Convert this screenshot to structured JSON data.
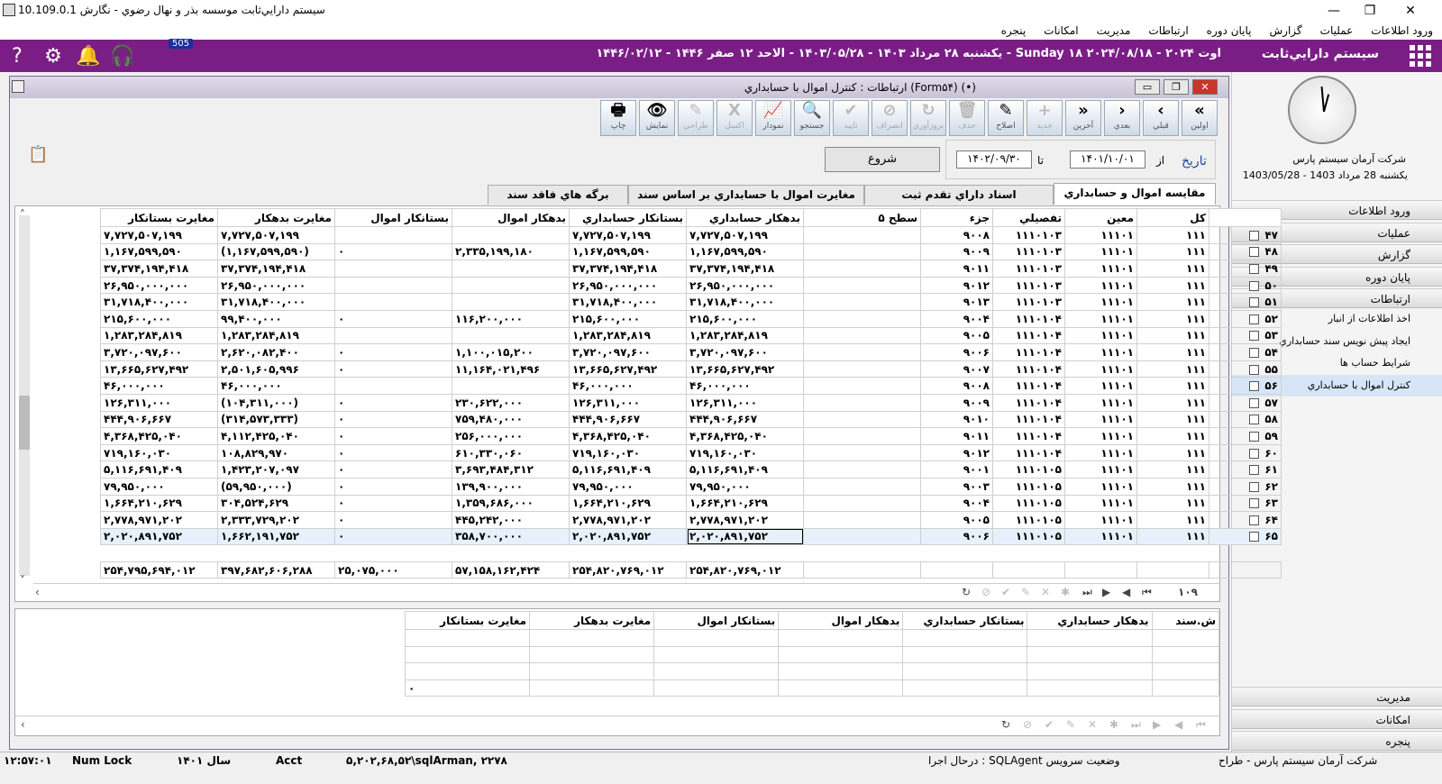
{
  "window": {
    "title": "سيستم دارايي‌ثابت موسسه بذر و نهال رضوي - نگارش 10.109.0.1"
  },
  "menubar": [
    "ورود اطلاعات",
    "عمليات",
    "گزارش",
    "پايان دوره",
    "ارتباطات",
    "مديريت",
    "امکانات",
    "پنجره"
  ],
  "topbar": {
    "brand": "سيستم دارايي‌ثابت",
    "date": "يكشنبه ۲۸ مرداد ۱۴۰۳ - ۱۴۰۳/۰۵/۲۸ - الاحد ۱۲ صفر ۱۴۴۶ - ۱۴۴۶/۰۲/۱۲ - Sunday ۱۸ اوت ۲۰۲۴ - ۲۰۲۴/۰۸/۱۸",
    "badge": "505"
  },
  "rightpanel": {
    "company": "شرکت آرمان سيستم پارس",
    "date": "يکشنبه 28 مرداد 1403 - 1403/05/28",
    "menus_top": [
      "ورود اطلاعات",
      "عمليات",
      "گزارش",
      "پايان دوره",
      "ارتباطات"
    ],
    "sub": [
      "اخذ اطلاعات از انبار",
      "ايجاد پيش نويس سند حسابداري",
      "شرايط حساب ها",
      "کنترل اموال با حسابداري"
    ],
    "menus_bottom": [
      "مديريت",
      "امکانات",
      "پنجره"
    ]
  },
  "form": {
    "title": "ارتباطات : کنترل اموال با حسابداري (Form۵۴) (•)"
  },
  "toolbar": [
    {
      "l": "اولين",
      "i": "«",
      "d": false
    },
    {
      "l": "قبلي",
      "i": "‹",
      "d": false
    },
    {
      "l": "بعدي",
      "i": "›",
      "d": false
    },
    {
      "l": "آخرين",
      "i": "»",
      "d": false
    },
    {
      "l": "جديد",
      "i": "+",
      "d": true
    },
    {
      "l": "اصلاح",
      "i": "✎",
      "d": false
    },
    {
      "l": "حذف",
      "i": "🗑",
      "d": true
    },
    {
      "l": "بروزآوري",
      "i": "↻",
      "d": true
    },
    {
      "l": "انصراف",
      "i": "⊘",
      "d": true
    },
    {
      "l": "تاييد",
      "i": "✔",
      "d": true
    },
    {
      "l": "جستجو",
      "i": "🔍",
      "d": false
    },
    {
      "l": "نمودار",
      "i": "📈",
      "d": false
    },
    {
      "l": "اکسل",
      "i": "X",
      "d": true
    },
    {
      "l": "طراحي",
      "i": "✎",
      "d": true
    },
    {
      "l": "نمايش",
      "i": "👁",
      "d": false
    },
    {
      "l": "چاپ",
      "i": "🖶",
      "d": false
    }
  ],
  "filter": {
    "date_label": "تاريخ",
    "from_label": "از",
    "from": "۱۴۰۱/۱۰/۰۱",
    "to_label": "تا",
    "to": "۱۴۰۲/۰۹/۳۰",
    "start": "شروع"
  },
  "tabs": [
    "مقايسه اموال و حسابداري",
    "اسناد داراي تقدم ثبت",
    "مغايرت اموال با حسابداري بر اساس سند",
    "برگه هاي فاقد سند"
  ],
  "columns": [
    "کل",
    "معين",
    "تفصيلي",
    "جزء",
    "سطح ۵",
    "بدهکار حسابداري",
    "بستانکار حسابداري",
    "بدهکار اموال",
    "بستانکار اموال",
    "مغايرت بدهکار",
    "مغايرت بستانکار"
  ],
  "rows": [
    [
      "۴۷",
      "۱۱۱",
      "۱۱۱۰۱",
      "۱۱۱۰۱۰۳",
      "۹۰۰۸",
      "",
      "۷,۷۲۷,۵۰۷,۱۹۹",
      "۷,۷۲۷,۵۰۷,۱۹۹",
      "",
      "",
      "۷,۷۲۷,۵۰۷,۱۹۹",
      "۷,۷۲۷,۵۰۷,۱۹۹"
    ],
    [
      "۴۸",
      "۱۱۱",
      "۱۱۱۰۱",
      "۱۱۱۰۱۰۳",
      "۹۰۰۹",
      "",
      "۱,۱۶۷,۵۹۹,۵۹۰",
      "۱,۱۶۷,۵۹۹,۵۹۰",
      "۲,۳۳۵,۱۹۹,۱۸۰",
      "۰",
      "(۱,۱۶۷,۵۹۹,۵۹۰)",
      "۱,۱۶۷,۵۹۹,۵۹۰"
    ],
    [
      "۴۹",
      "۱۱۱",
      "۱۱۱۰۱",
      "۱۱۱۰۱۰۳",
      "۹۰۱۱",
      "",
      "۳۷,۳۷۴,۱۹۴,۴۱۸",
      "۳۷,۳۷۴,۱۹۴,۴۱۸",
      "",
      "",
      "۳۷,۳۷۴,۱۹۴,۴۱۸",
      "۳۷,۳۷۴,۱۹۴,۴۱۸"
    ],
    [
      "۵۰",
      "۱۱۱",
      "۱۱۱۰۱",
      "۱۱۱۰۱۰۳",
      "۹۰۱۲",
      "",
      "۲۶,۹۵۰,۰۰۰,۰۰۰",
      "۲۶,۹۵۰,۰۰۰,۰۰۰",
      "",
      "",
      "۲۶,۹۵۰,۰۰۰,۰۰۰",
      "۲۶,۹۵۰,۰۰۰,۰۰۰"
    ],
    [
      "۵۱",
      "۱۱۱",
      "۱۱۱۰۱",
      "۱۱۱۰۱۰۳",
      "۹۰۱۳",
      "",
      "۳۱,۷۱۸,۴۰۰,۰۰۰",
      "۳۱,۷۱۸,۴۰۰,۰۰۰",
      "",
      "",
      "۳۱,۷۱۸,۴۰۰,۰۰۰",
      "۳۱,۷۱۸,۴۰۰,۰۰۰"
    ],
    [
      "۵۲",
      "۱۱۱",
      "۱۱۱۰۱",
      "۱۱۱۰۱۰۴",
      "۹۰۰۴",
      "",
      "۲۱۵,۶۰۰,۰۰۰",
      "۲۱۵,۶۰۰,۰۰۰",
      "۱۱۶,۲۰۰,۰۰۰",
      "۰",
      "۹۹,۴۰۰,۰۰۰",
      "۲۱۵,۶۰۰,۰۰۰"
    ],
    [
      "۵۳",
      "۱۱۱",
      "۱۱۱۰۱",
      "۱۱۱۰۱۰۴",
      "۹۰۰۵",
      "",
      "۱,۲۸۳,۲۸۴,۸۱۹",
      "۱,۲۸۳,۲۸۴,۸۱۹",
      "",
      "",
      "۱,۲۸۳,۲۸۴,۸۱۹",
      "۱,۲۸۳,۲۸۴,۸۱۹"
    ],
    [
      "۵۴",
      "۱۱۱",
      "۱۱۱۰۱",
      "۱۱۱۰۱۰۴",
      "۹۰۰۶",
      "",
      "۳,۷۲۰,۰۹۷,۶۰۰",
      "۳,۷۲۰,۰۹۷,۶۰۰",
      "۱,۱۰۰,۰۱۵,۲۰۰",
      "۰",
      "۲,۶۲۰,۰۸۲,۴۰۰",
      "۳,۷۲۰,۰۹۷,۶۰۰"
    ],
    [
      "۵۵",
      "۱۱۱",
      "۱۱۱۰۱",
      "۱۱۱۰۱۰۴",
      "۹۰۰۷",
      "",
      "۱۳,۶۶۵,۶۲۷,۴۹۲",
      "۱۳,۶۶۵,۶۲۷,۴۹۲",
      "۱۱,۱۶۴,۰۲۱,۴۹۶",
      "۰",
      "۲,۵۰۱,۶۰۵,۹۹۶",
      "۱۳,۶۶۵,۶۲۷,۴۹۲"
    ],
    [
      "۵۶",
      "۱۱۱",
      "۱۱۱۰۱",
      "۱۱۱۰۱۰۴",
      "۹۰۰۸",
      "",
      "۴۶,۰۰۰,۰۰۰",
      "۴۶,۰۰۰,۰۰۰",
      "",
      "",
      "۴۶,۰۰۰,۰۰۰",
      "۴۶,۰۰۰,۰۰۰"
    ],
    [
      "۵۷",
      "۱۱۱",
      "۱۱۱۰۱",
      "۱۱۱۰۱۰۴",
      "۹۰۰۹",
      "",
      "۱۲۶,۳۱۱,۰۰۰",
      "۱۲۶,۳۱۱,۰۰۰",
      "۲۳۰,۶۲۲,۰۰۰",
      "۰",
      "(۱۰۴,۳۱۱,۰۰۰)",
      "۱۲۶,۳۱۱,۰۰۰"
    ],
    [
      "۵۸",
      "۱۱۱",
      "۱۱۱۰۱",
      "۱۱۱۰۱۰۴",
      "۹۰۱۰",
      "",
      "۴۴۴,۹۰۶,۶۶۷",
      "۴۴۴,۹۰۶,۶۶۷",
      "۷۵۹,۴۸۰,۰۰۰",
      "۰",
      "(۳۱۴,۵۷۳,۳۳۳)",
      "۴۴۴,۹۰۶,۶۶۷"
    ],
    [
      "۵۹",
      "۱۱۱",
      "۱۱۱۰۱",
      "۱۱۱۰۱۰۴",
      "۹۰۱۱",
      "",
      "۴,۳۶۸,۴۲۵,۰۴۰",
      "۴,۳۶۸,۴۲۵,۰۴۰",
      "۲۵۶,۰۰۰,۰۰۰",
      "۰",
      "۴,۱۱۲,۴۲۵,۰۴۰",
      "۴,۳۶۸,۴۲۵,۰۴۰"
    ],
    [
      "۶۰",
      "۱۱۱",
      "۱۱۱۰۱",
      "۱۱۱۰۱۰۴",
      "۹۰۱۲",
      "",
      "۷۱۹,۱۶۰,۰۳۰",
      "۷۱۹,۱۶۰,۰۳۰",
      "۶۱۰,۳۳۰,۰۶۰",
      "۰",
      "۱۰۸,۸۲۹,۹۷۰",
      "۷۱۹,۱۶۰,۰۳۰"
    ],
    [
      "۶۱",
      "۱۱۱",
      "۱۱۱۰۱",
      "۱۱۱۰۱۰۵",
      "۹۰۰۱",
      "",
      "۵,۱۱۶,۶۹۱,۴۰۹",
      "۵,۱۱۶,۶۹۱,۴۰۹",
      "۳,۶۹۳,۴۸۴,۳۱۲",
      "۰",
      "۱,۴۲۳,۲۰۷,۰۹۷",
      "۵,۱۱۶,۶۹۱,۴۰۹"
    ],
    [
      "۶۲",
      "۱۱۱",
      "۱۱۱۰۱",
      "۱۱۱۰۱۰۵",
      "۹۰۰۳",
      "",
      "۷۹,۹۵۰,۰۰۰",
      "۷۹,۹۵۰,۰۰۰",
      "۱۳۹,۹۰۰,۰۰۰",
      "۰",
      "(۵۹,۹۵۰,۰۰۰)",
      "۷۹,۹۵۰,۰۰۰"
    ],
    [
      "۶۳",
      "۱۱۱",
      "۱۱۱۰۱",
      "۱۱۱۰۱۰۵",
      "۹۰۰۴",
      "",
      "۱,۶۶۴,۲۱۰,۶۲۹",
      "۱,۶۶۴,۲۱۰,۶۲۹",
      "۱,۳۵۹,۶۸۶,۰۰۰",
      "۰",
      "۳۰۴,۵۲۴,۶۲۹",
      "۱,۶۶۴,۲۱۰,۶۲۹"
    ],
    [
      "۶۴",
      "۱۱۱",
      "۱۱۱۰۱",
      "۱۱۱۰۱۰۵",
      "۹۰۰۵",
      "",
      "۲,۷۷۸,۹۷۱,۲۰۲",
      "۲,۷۷۸,۹۷۱,۲۰۲",
      "۴۴۵,۲۴۲,۰۰۰",
      "۰",
      "۲,۳۳۳,۷۲۹,۲۰۲",
      "۲,۷۷۸,۹۷۱,۲۰۲"
    ],
    [
      "۶۵",
      "۱۱۱",
      "۱۱۱۰۱",
      "۱۱۱۰۱۰۵",
      "۹۰۰۶",
      "",
      "۲,۰۲۰,۸۹۱,۷۵۲",
      "۲,۰۲۰,۸۹۱,۷۵۲",
      "۳۵۸,۷۰۰,۰۰۰",
      "۰",
      "۱,۶۶۲,۱۹۱,۷۵۲",
      "۲,۰۲۰,۸۹۱,۷۵۲"
    ]
  ],
  "totals": [
    "۲۵۴,۸۲۰,۷۶۹,۰۱۲",
    "۲۵۴,۸۲۰,۷۶۹,۰۱۲",
    "۵۷,۱۵۸,۱۶۲,۴۲۴",
    "۲۵,۰۷۵,۰۰۰",
    "۳۹۷,۶۸۲,۶۰۶,۲۸۸",
    "۲۵۴,۷۹۵,۶۹۴,۰۱۲"
  ],
  "record_count": "۱۰۹",
  "columns2": [
    "ش.سند",
    "بدهکار حسابداري",
    "بستانکار حسابداري",
    "بدهکار اموال",
    "بستانکار اموال",
    "مغايرت بدهکار",
    "مغايرت بستانکار"
  ],
  "total2": "۰",
  "status": {
    "company": "شرکت آرمان سيستم پارس - طراح",
    "agent": "درحال اجرا : SQLAgent وضعيت سرويس",
    "db": "۵,۲۰۲,۶۸,۵۲\\sqlArman, ۲۲۷۸",
    "acct": "Acct",
    "year": "سال ۱۴۰۱",
    "numlock": "Num Lock",
    "time": "۱۲:۵۷:۰۱"
  }
}
